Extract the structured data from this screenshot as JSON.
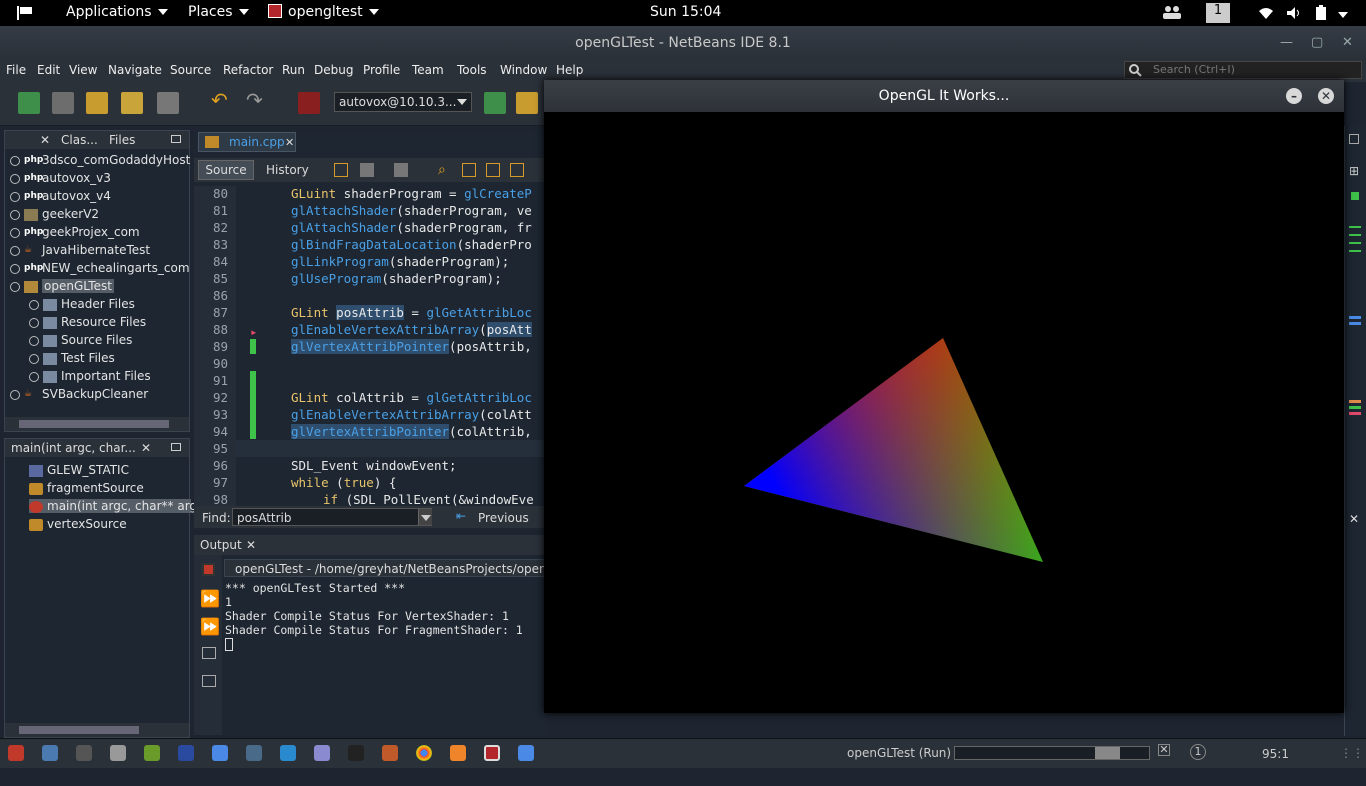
{
  "topbar": {
    "activities": "activities-icon",
    "applications": "Applications",
    "places": "Places",
    "app_menu": "opengltest",
    "clock": "Sun 15:04",
    "workspace": "1"
  },
  "window": {
    "title": "openGLTest - NetBeans IDE 8.1"
  },
  "menu": [
    "File",
    "Edit",
    "View",
    "Navigate",
    "Source",
    "Refactor",
    "Run",
    "Debug",
    "Profile",
    "Team",
    "Tools",
    "Window",
    "Help"
  ],
  "search": {
    "placeholder": "Search (Ctrl+I)"
  },
  "toolbar": {
    "config": "autovox@10.10.3..."
  },
  "projects": {
    "tabs": [
      "Clas...",
      "Files"
    ],
    "items": [
      "3dsco_comGodaddyHost",
      "autovox_v3",
      "autovox_v4",
      "geekerV2",
      "geekProjex_com",
      "JavaHibernateTest",
      "NEW_echealingarts_com",
      "openGLTest"
    ],
    "children": [
      "Header Files",
      "Resource Files",
      "Source Files",
      "Test Files",
      "Important Files"
    ],
    "last": "SVBackupCleaner"
  },
  "navigator": {
    "title": "main(int argc, char...",
    "items": [
      "GLEW_STATIC",
      "fragmentSource",
      "main(int argc, char** argv)",
      "vertexSource"
    ]
  },
  "editor": {
    "tab": "main.cpp",
    "source_tab": "Source",
    "history_tab": "History",
    "line_numbers": [
      "80",
      "81",
      "82",
      "83",
      "84",
      "85",
      "86",
      "87",
      "88",
      "89",
      "90",
      "91",
      "92",
      "93",
      "94",
      "95",
      "96",
      "97",
      "98"
    ],
    "find_label": "Find:",
    "find_value": "posAttrib",
    "previous": "Previous"
  },
  "output": {
    "title": "Output",
    "run_tab": "openGLTest - /home/greyhat/NetBeansProjects/openG",
    "lines": [
      "*** openGLTest Started ***",
      "1",
      "Shader Compile Status For VertexShader: 1",
      "Shader Compile Status For FragmentShader: 1"
    ]
  },
  "glwindow": {
    "title": "OpenGL It Works..."
  },
  "status": {
    "run": "openGLTest (Run)",
    "position": "95:1",
    "notifications": "1",
    "progress": 0.85
  },
  "colors": {
    "accent": "#4aa0e6",
    "keyword": "#e9c46a",
    "bg": "#1d2631"
  }
}
